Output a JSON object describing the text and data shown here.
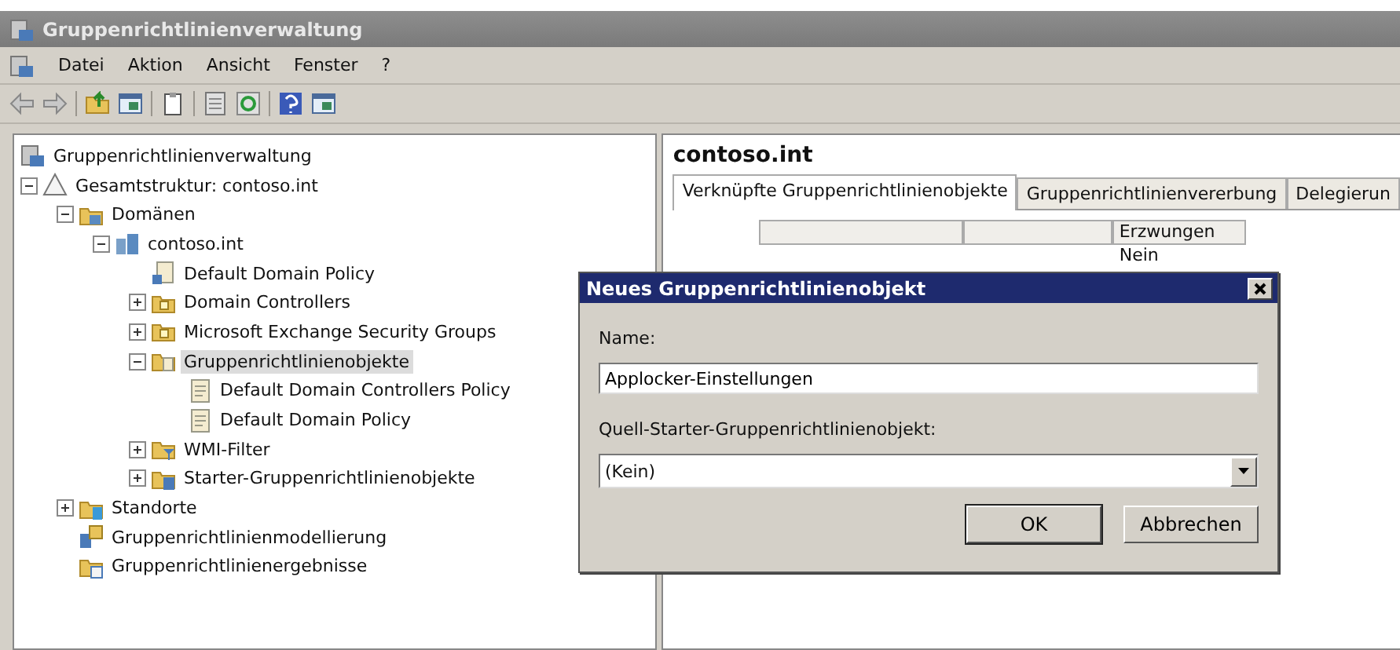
{
  "window": {
    "title": "Gruppenrichtlinienverwaltung"
  },
  "menu": [
    "Datei",
    "Aktion",
    "Ansicht",
    "Fenster",
    "?"
  ],
  "toolbar": [
    {
      "kind": "back"
    },
    {
      "kind": "forward"
    },
    {
      "kind": "sep"
    },
    {
      "kind": "up"
    },
    {
      "kind": "pane"
    },
    {
      "kind": "sep"
    },
    {
      "kind": "clipboard"
    },
    {
      "kind": "sep"
    },
    {
      "kind": "export"
    },
    {
      "kind": "refresh"
    },
    {
      "kind": "sep"
    },
    {
      "kind": "help"
    },
    {
      "kind": "pane"
    }
  ],
  "tree": [
    {
      "label": "Gruppenrichtlinienverwaltung",
      "kind": "console",
      "selected": false,
      "children": [
        {
          "label": "Gesamtstruktur: contoso.int",
          "kind": "forest",
          "expanded": true,
          "selected": false,
          "children": [
            {
              "label": "Domänen",
              "kind": "domains",
              "expanded": true,
              "selected": false,
              "children": [
                {
                  "label": "contoso.int",
                  "kind": "domain",
                  "expanded": true,
                  "selected": false,
                  "children": [
                    {
                      "label": "Default Domain Policy",
                      "kind": "link",
                      "selected": false
                    },
                    {
                      "label": "Domain Controllers",
                      "kind": "ou",
                      "expanded": false,
                      "selected": false
                    },
                    {
                      "label": "Microsoft Exchange Security Groups",
                      "kind": "ou",
                      "expanded": false,
                      "selected": false
                    },
                    {
                      "label": "Gruppenrichtlinienobjekte",
                      "kind": "gpofolder",
                      "expanded": true,
                      "selected": true,
                      "children": [
                        {
                          "label": "Default Domain Controllers Policy",
                          "kind": "gpo",
                          "selected": false
                        },
                        {
                          "label": "Default Domain Policy",
                          "kind": "gpo",
                          "selected": false
                        }
                      ]
                    },
                    {
                      "label": "WMI-Filter",
                      "kind": "filter",
                      "expanded": false,
                      "selected": false
                    },
                    {
                      "label": "Starter-Gruppenrichtlinienobjekte",
                      "kind": "starter",
                      "expanded": false,
                      "selected": false
                    }
                  ]
                }
              ]
            },
            {
              "label": "Standorte",
              "kind": "sites",
              "expanded": false,
              "selected": false
            },
            {
              "label": "Gruppenrichtlinienmodellierung",
              "kind": "modeling",
              "selected": false
            },
            {
              "label": "Gruppenrichtlinienergebnisse",
              "kind": "results",
              "selected": false
            }
          ]
        }
      ]
    }
  ],
  "details": {
    "heading": "contoso.int",
    "tabs": [
      {
        "label": "Verknüpfte Gruppenrichtlinienobjekte",
        "selected": true
      },
      {
        "label": "Gruppenrichtlinienvererbung",
        "selected": false
      },
      {
        "label": "Delegierun",
        "selected": false
      }
    ],
    "columns": [
      "Erzwungen"
    ],
    "rows": [
      [
        "Nein"
      ]
    ]
  },
  "dialog": {
    "title": "Neues Gruppenrichtlinienobjekt",
    "name_label": "Name:",
    "name_value": "Applocker-Einstellungen",
    "source_label": "Quell-Starter-Gruppenrichtlinienobjekt:",
    "source_value": "(Kein)",
    "buttons": [
      {
        "label": "OK",
        "default": true
      },
      {
        "label": "Abbrechen",
        "default": false
      }
    ]
  }
}
